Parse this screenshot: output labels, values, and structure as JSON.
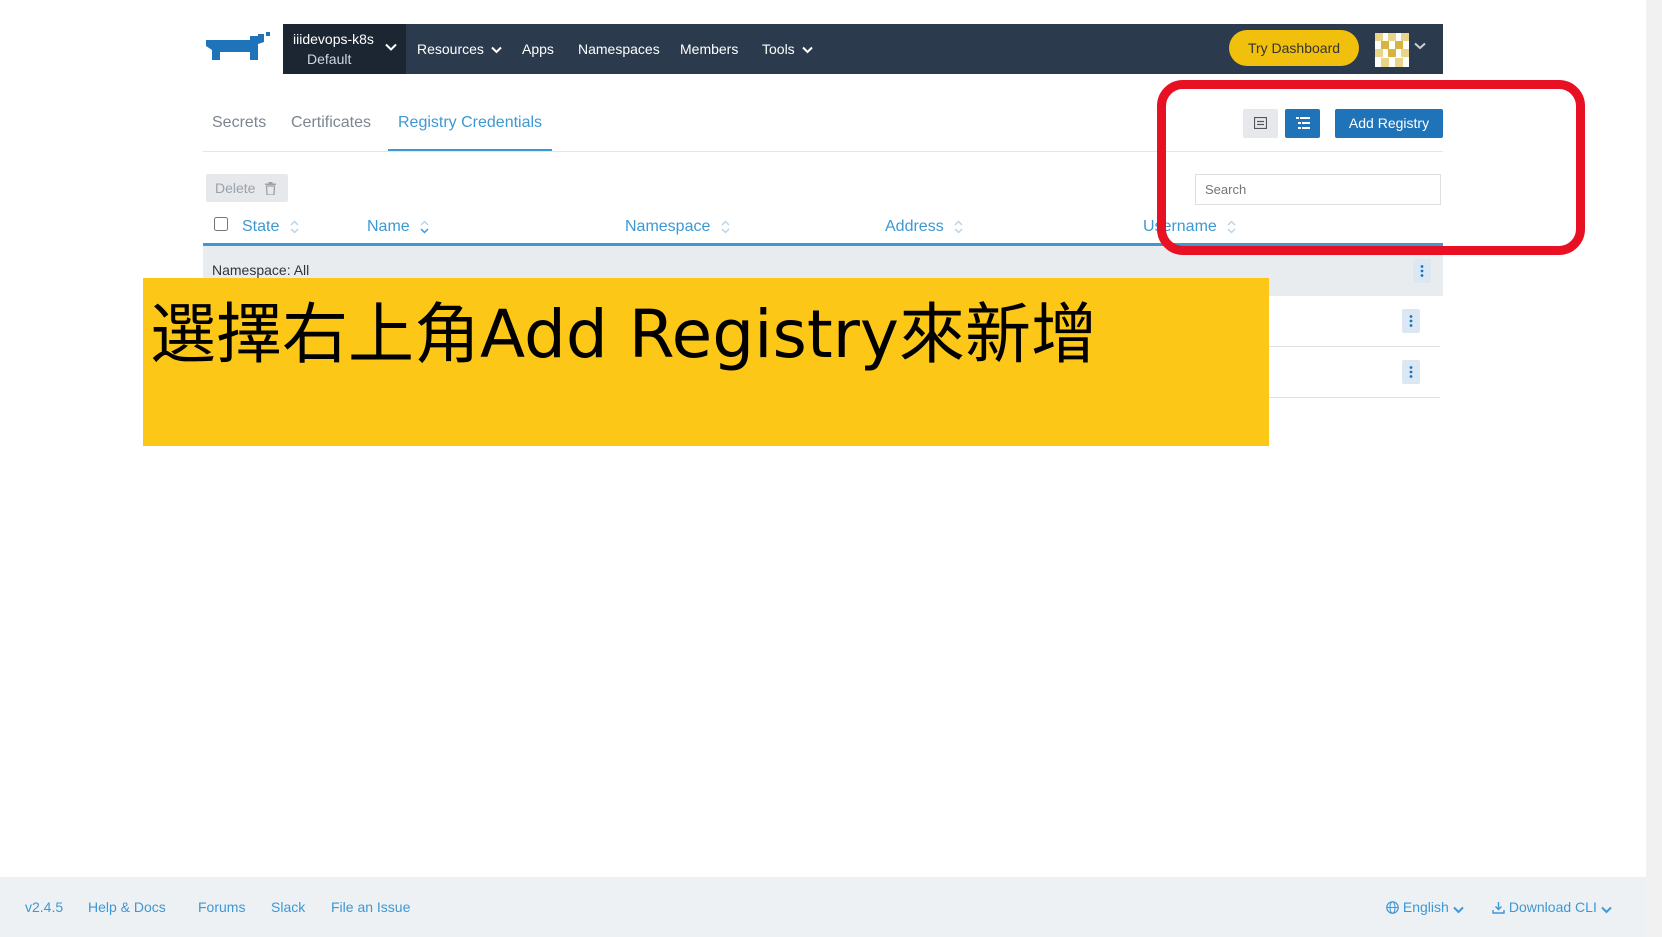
{
  "nav": {
    "cluster_name": "iiidevops-k8s",
    "project_name": "Default",
    "menu": [
      "Resources",
      "Apps",
      "Namespaces",
      "Members",
      "Tools"
    ],
    "try_dashboard": "Try Dashboard"
  },
  "tabs": [
    "Secrets",
    "Certificates",
    "Registry Credentials"
  ],
  "toolbar": {
    "add_registry": "Add Registry",
    "delete_label": "Delete",
    "search_placeholder": "Search"
  },
  "table": {
    "columns": [
      "State",
      "Name",
      "Namespace",
      "Address",
      "Username"
    ],
    "group_label": "Namespace: All"
  },
  "annotation": {
    "text": "選擇右上角Add Registry來新增"
  },
  "footer": {
    "version": "v2.4.5",
    "links": [
      "Help & Docs",
      "Forums",
      "Slack",
      "File an Issue"
    ],
    "language": "English",
    "download": "Download CLI"
  },
  "colors": {
    "nav_bg": "#2b3a4d",
    "accent": "#3d98d3",
    "primary_button": "#1e73b9",
    "try_dashboard": "#f1c00c",
    "annotation_bg": "#fdc718",
    "highlight_border": "#e81123"
  }
}
